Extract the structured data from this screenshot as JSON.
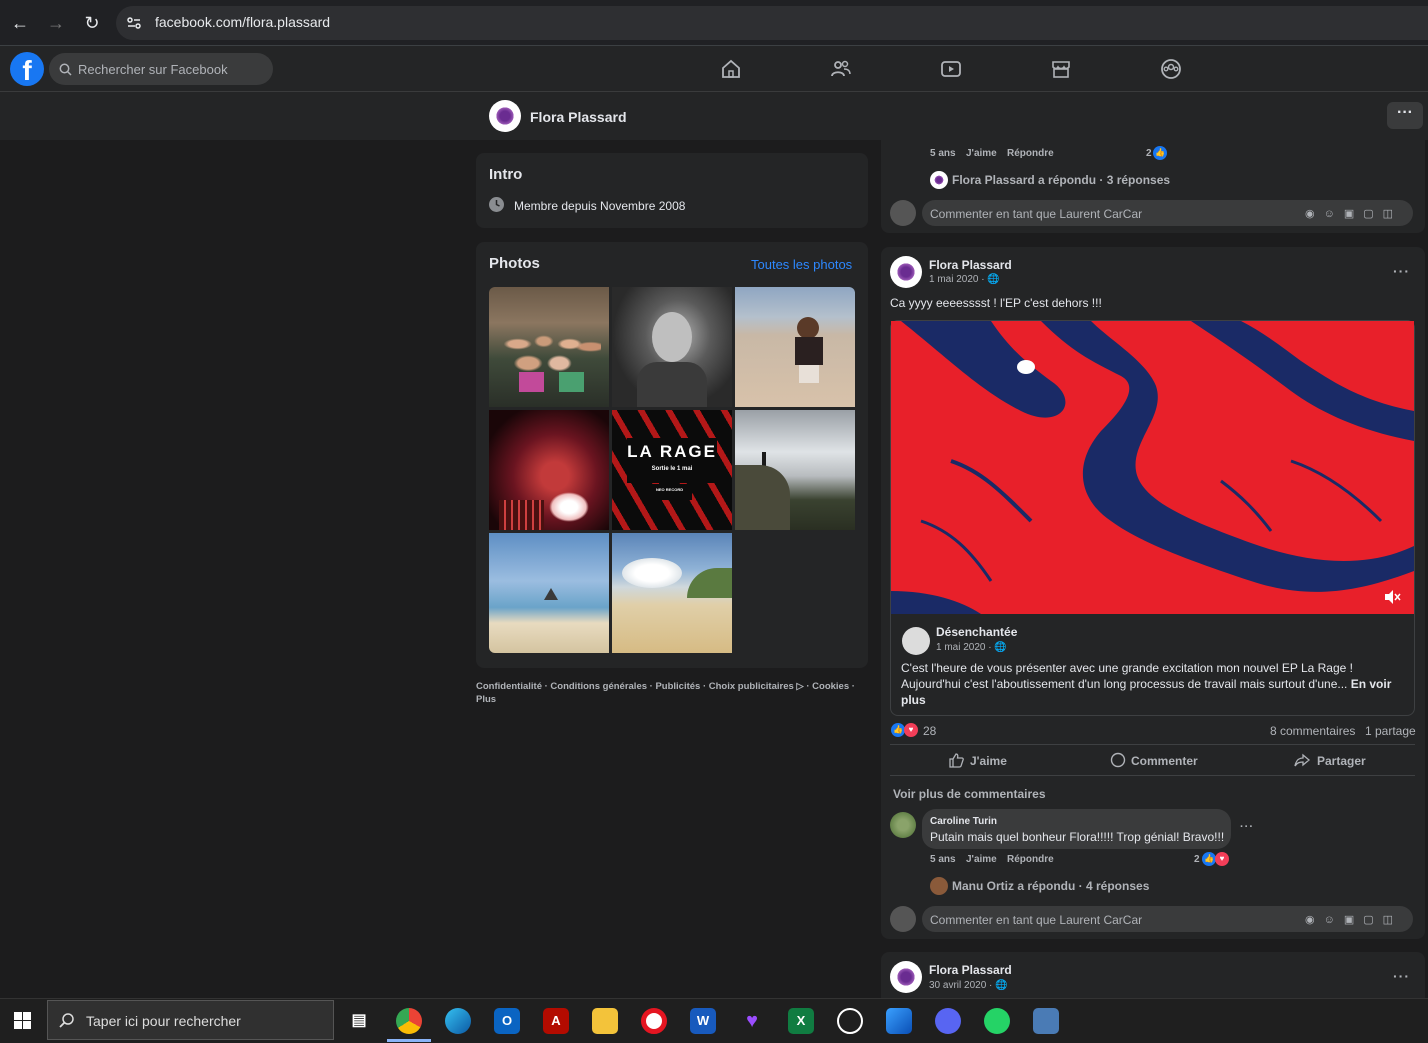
{
  "browser": {
    "url": "facebook.com/flora.plassard"
  },
  "fb": {
    "search_placeholder": "Rechercher sur Facebook"
  },
  "profile": {
    "name": "Flora Plassard"
  },
  "intro": {
    "title": "Intro",
    "member_since": "Membre depuis Novembre 2008"
  },
  "photos": {
    "title": "Photos",
    "all_link": "Toutes les photos",
    "la_rage_title": "LA RAGE",
    "la_rage_sub": "Sortie le 1 mai",
    "la_rage_label": "NEO RECORD"
  },
  "footer": {
    "text": "Confidentialité · Conditions générales · Publicités · Choix publicitaires ▷ · Cookies · Plus"
  },
  "prev_post": {
    "comment_time": "5 ans",
    "comment_like": "J'aime",
    "comment_reply": "Répondre",
    "comment_reaction_count": "2",
    "replies": "Flora Plassard a répondu · 3 réponses",
    "comment_as": "Commenter en tant que Laurent CarCar"
  },
  "post": {
    "author": "Flora Plassard",
    "date": "1 mai 2020 · ",
    "text": "Ca yyyy eeeesssst ! l'EP c'est dehors !!!",
    "shared_author": "Désenchantée",
    "shared_date": "1 mai 2020 · ",
    "shared_text": "C'est l'heure de vous présenter avec une grande excitation  mon nouvel EP La Rage ! Aujourd'hui c'est l'aboutissement d'un long processus de travail mais surtout d'une...",
    "see_more": "En voir plus",
    "reaction_count": "28",
    "comments_count": "8 commentaires",
    "shares_count": "1 partage",
    "like_label": "J'aime",
    "comment_label": "Commenter",
    "share_label": "Partager",
    "see_more_comments": "Voir plus de commentaires",
    "comment_author": "Caroline Turin",
    "comment_text": "Putain mais quel bonheur Flora!!!!! Trop génial! Bravo!!!",
    "comment_time": "5 ans",
    "comment_like": "J'aime",
    "comment_reply": "Répondre",
    "comment_reaction_count": "2",
    "replies": "Manu Ortiz a répondu · 4 réponses",
    "comment_as": "Commenter en tant que Laurent CarCar"
  },
  "next_post": {
    "author": "Flora Plassard",
    "date": "30 avril 2020 · "
  },
  "taskbar": {
    "search_placeholder": "Taper ici pour rechercher"
  },
  "colors": {
    "fb_blue": "#1877f2",
    "video_red": "#e8202a",
    "video_navy": "#1a2a66"
  }
}
